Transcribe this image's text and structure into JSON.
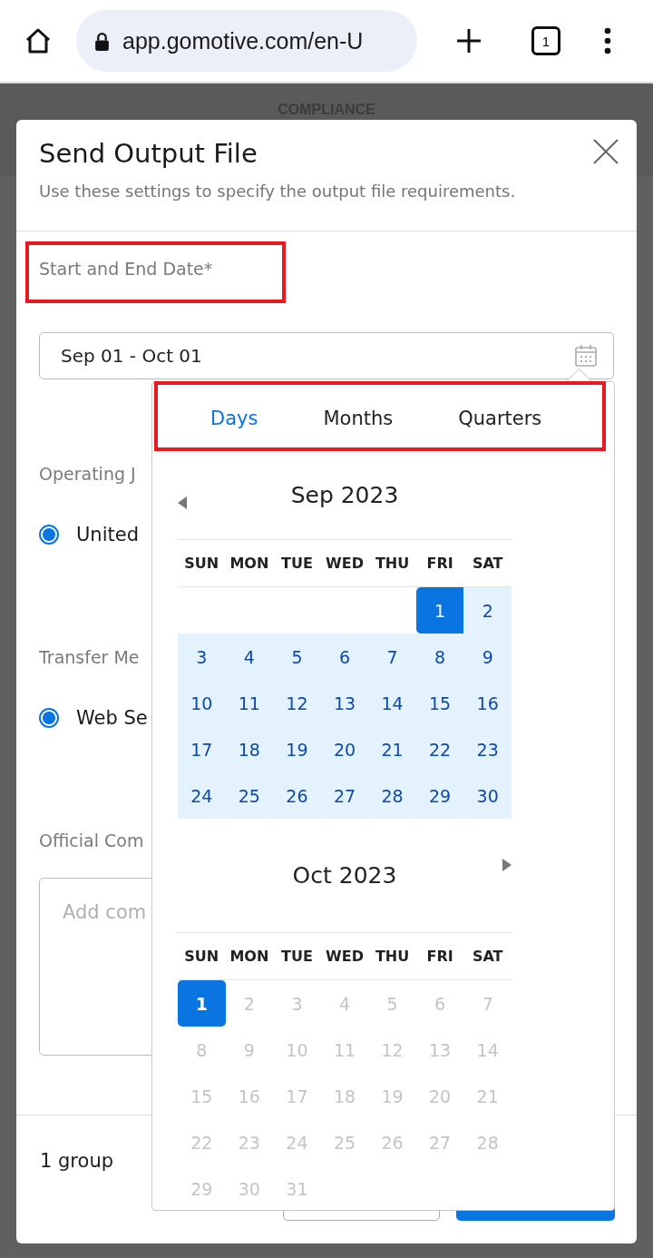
{
  "browser": {
    "url": "app.gomotive.com/en-U",
    "tab_count": "1"
  },
  "page": {
    "header": "COMPLIANCE"
  },
  "modal": {
    "title": "Send Output File",
    "subtitle": "Use these settings to specify the output file requirements.",
    "date_field": {
      "label": "Start and End Date*",
      "label_highlighted": true,
      "value": "Sep 01 - Oct 01"
    },
    "sections": [
      {
        "label": "Operating J",
        "option": "United",
        "selected": true
      },
      {
        "label": "Transfer Me",
        "option": "Web Se",
        "selected": true
      }
    ],
    "comment": {
      "label": "Official Com",
      "placeholder": "Add com"
    },
    "footer": {
      "count": "1 group"
    }
  },
  "date_picker": {
    "tabs_highlighted": true,
    "tabs": [
      {
        "label": "Days",
        "selected": true
      },
      {
        "label": "Months",
        "selected": false
      },
      {
        "label": "Quarters",
        "selected": false
      }
    ],
    "months": [
      {
        "title": "Sep 2023",
        "prev_arrow": true,
        "next_arrow": false,
        "weekdays": [
          "SUN",
          "MON",
          "TUE",
          "WED",
          "THU",
          "FRI",
          "SAT"
        ],
        "weeks": [
          [
            {
              "day": "1",
              "selected": true,
              "in_range": true
            },
            {
              "day": "2",
              "selected": false,
              "in_range": true
            }
          ],
          [
            {
              "day": "3",
              "selected": false,
              "in_range": true
            },
            {
              "day": "4",
              "selected": false,
              "in_range": true
            },
            {
              "day": "5",
              "selected": false,
              "in_range": true
            },
            {
              "day": "6",
              "selected": false,
              "in_range": true
            },
            {
              "day": "7",
              "selected": false,
              "in_range": true
            },
            {
              "day": "8",
              "selected": false,
              "in_range": true
            },
            {
              "day": "9",
              "selected": false,
              "in_range": true
            }
          ],
          [
            {
              "day": "10",
              "selected": false,
              "in_range": true
            },
            {
              "day": "11",
              "selected": false,
              "in_range": true
            },
            {
              "day": "12",
              "selected": false,
              "in_range": true
            },
            {
              "day": "13",
              "selected": false,
              "in_range": true
            },
            {
              "day": "14",
              "selected": false,
              "in_range": true
            },
            {
              "day": "15",
              "selected": false,
              "in_range": true
            },
            {
              "day": "16",
              "selected": false,
              "in_range": true
            }
          ],
          [
            {
              "day": "17",
              "selected": false,
              "in_range": true
            },
            {
              "day": "18",
              "selected": false,
              "in_range": true
            },
            {
              "day": "19",
              "selected": false,
              "in_range": true
            },
            {
              "day": "20",
              "selected": false,
              "in_range": true
            },
            {
              "day": "21",
              "selected": false,
              "in_range": true
            },
            {
              "day": "22",
              "selected": false,
              "in_range": true
            },
            {
              "day": "23",
              "selected": false,
              "in_range": true
            }
          ],
          [
            {
              "day": "24",
              "selected": false,
              "in_range": true
            },
            {
              "day": "25",
              "selected": false,
              "in_range": true
            },
            {
              "day": "26",
              "selected": false,
              "in_range": true
            },
            {
              "day": "27",
              "selected": false,
              "in_range": true
            },
            {
              "day": "28",
              "selected": false,
              "in_range": true
            },
            {
              "day": "29",
              "selected": false,
              "in_range": true
            },
            {
              "day": "30",
              "selected": false,
              "in_range": true
            }
          ]
        ]
      },
      {
        "title": "Oct 2023",
        "prev_arrow": false,
        "next_arrow": true,
        "weekdays": [
          "SUN",
          "MON",
          "TUE",
          "WED",
          "THU",
          "FRI",
          "SAT"
        ],
        "weeks": [
          [
            {
              "day": "1",
              "selected": true,
              "in_range": false
            },
            {
              "day": "2",
              "selected": false,
              "in_range": false
            },
            {
              "day": "3",
              "selected": false,
              "in_range": false
            },
            {
              "day": "4",
              "selected": false,
              "in_range": false
            },
            {
              "day": "5",
              "selected": false,
              "in_range": false
            },
            {
              "day": "6",
              "selected": false,
              "in_range": false
            },
            {
              "day": "7",
              "selected": false,
              "in_range": false
            }
          ],
          [
            {
              "day": "8",
              "selected": false,
              "in_range": false
            },
            {
              "day": "9",
              "selected": false,
              "in_range": false
            },
            {
              "day": "10",
              "selected": false,
              "in_range": false
            },
            {
              "day": "11",
              "selected": false,
              "in_range": false
            },
            {
              "day": "12",
              "selected": false,
              "in_range": false
            },
            {
              "day": "13",
              "selected": false,
              "in_range": false
            },
            {
              "day": "14",
              "selected": false,
              "in_range": false
            }
          ],
          [
            {
              "day": "15",
              "selected": false,
              "in_range": false
            },
            {
              "day": "16",
              "selected": false,
              "in_range": false
            },
            {
              "day": "17",
              "selected": false,
              "in_range": false
            },
            {
              "day": "18",
              "selected": false,
              "in_range": false
            },
            {
              "day": "19",
              "selected": false,
              "in_range": false
            },
            {
              "day": "20",
              "selected": false,
              "in_range": false
            },
            {
              "day": "21",
              "selected": false,
              "in_range": false
            }
          ],
          [
            {
              "day": "22",
              "selected": false,
              "in_range": false
            },
            {
              "day": "23",
              "selected": false,
              "in_range": false
            },
            {
              "day": "24",
              "selected": false,
              "in_range": false
            },
            {
              "day": "25",
              "selected": false,
              "in_range": false
            },
            {
              "day": "26",
              "selected": false,
              "in_range": false
            },
            {
              "day": "27",
              "selected": false,
              "in_range": false
            },
            {
              "day": "28",
              "selected": false,
              "in_range": false
            }
          ],
          [
            {
              "day": "29",
              "selected": false,
              "in_range": false
            },
            {
              "day": "30",
              "selected": false,
              "in_range": false
            },
            {
              "day": "31",
              "selected": false,
              "in_range": false
            }
          ]
        ]
      }
    ]
  }
}
